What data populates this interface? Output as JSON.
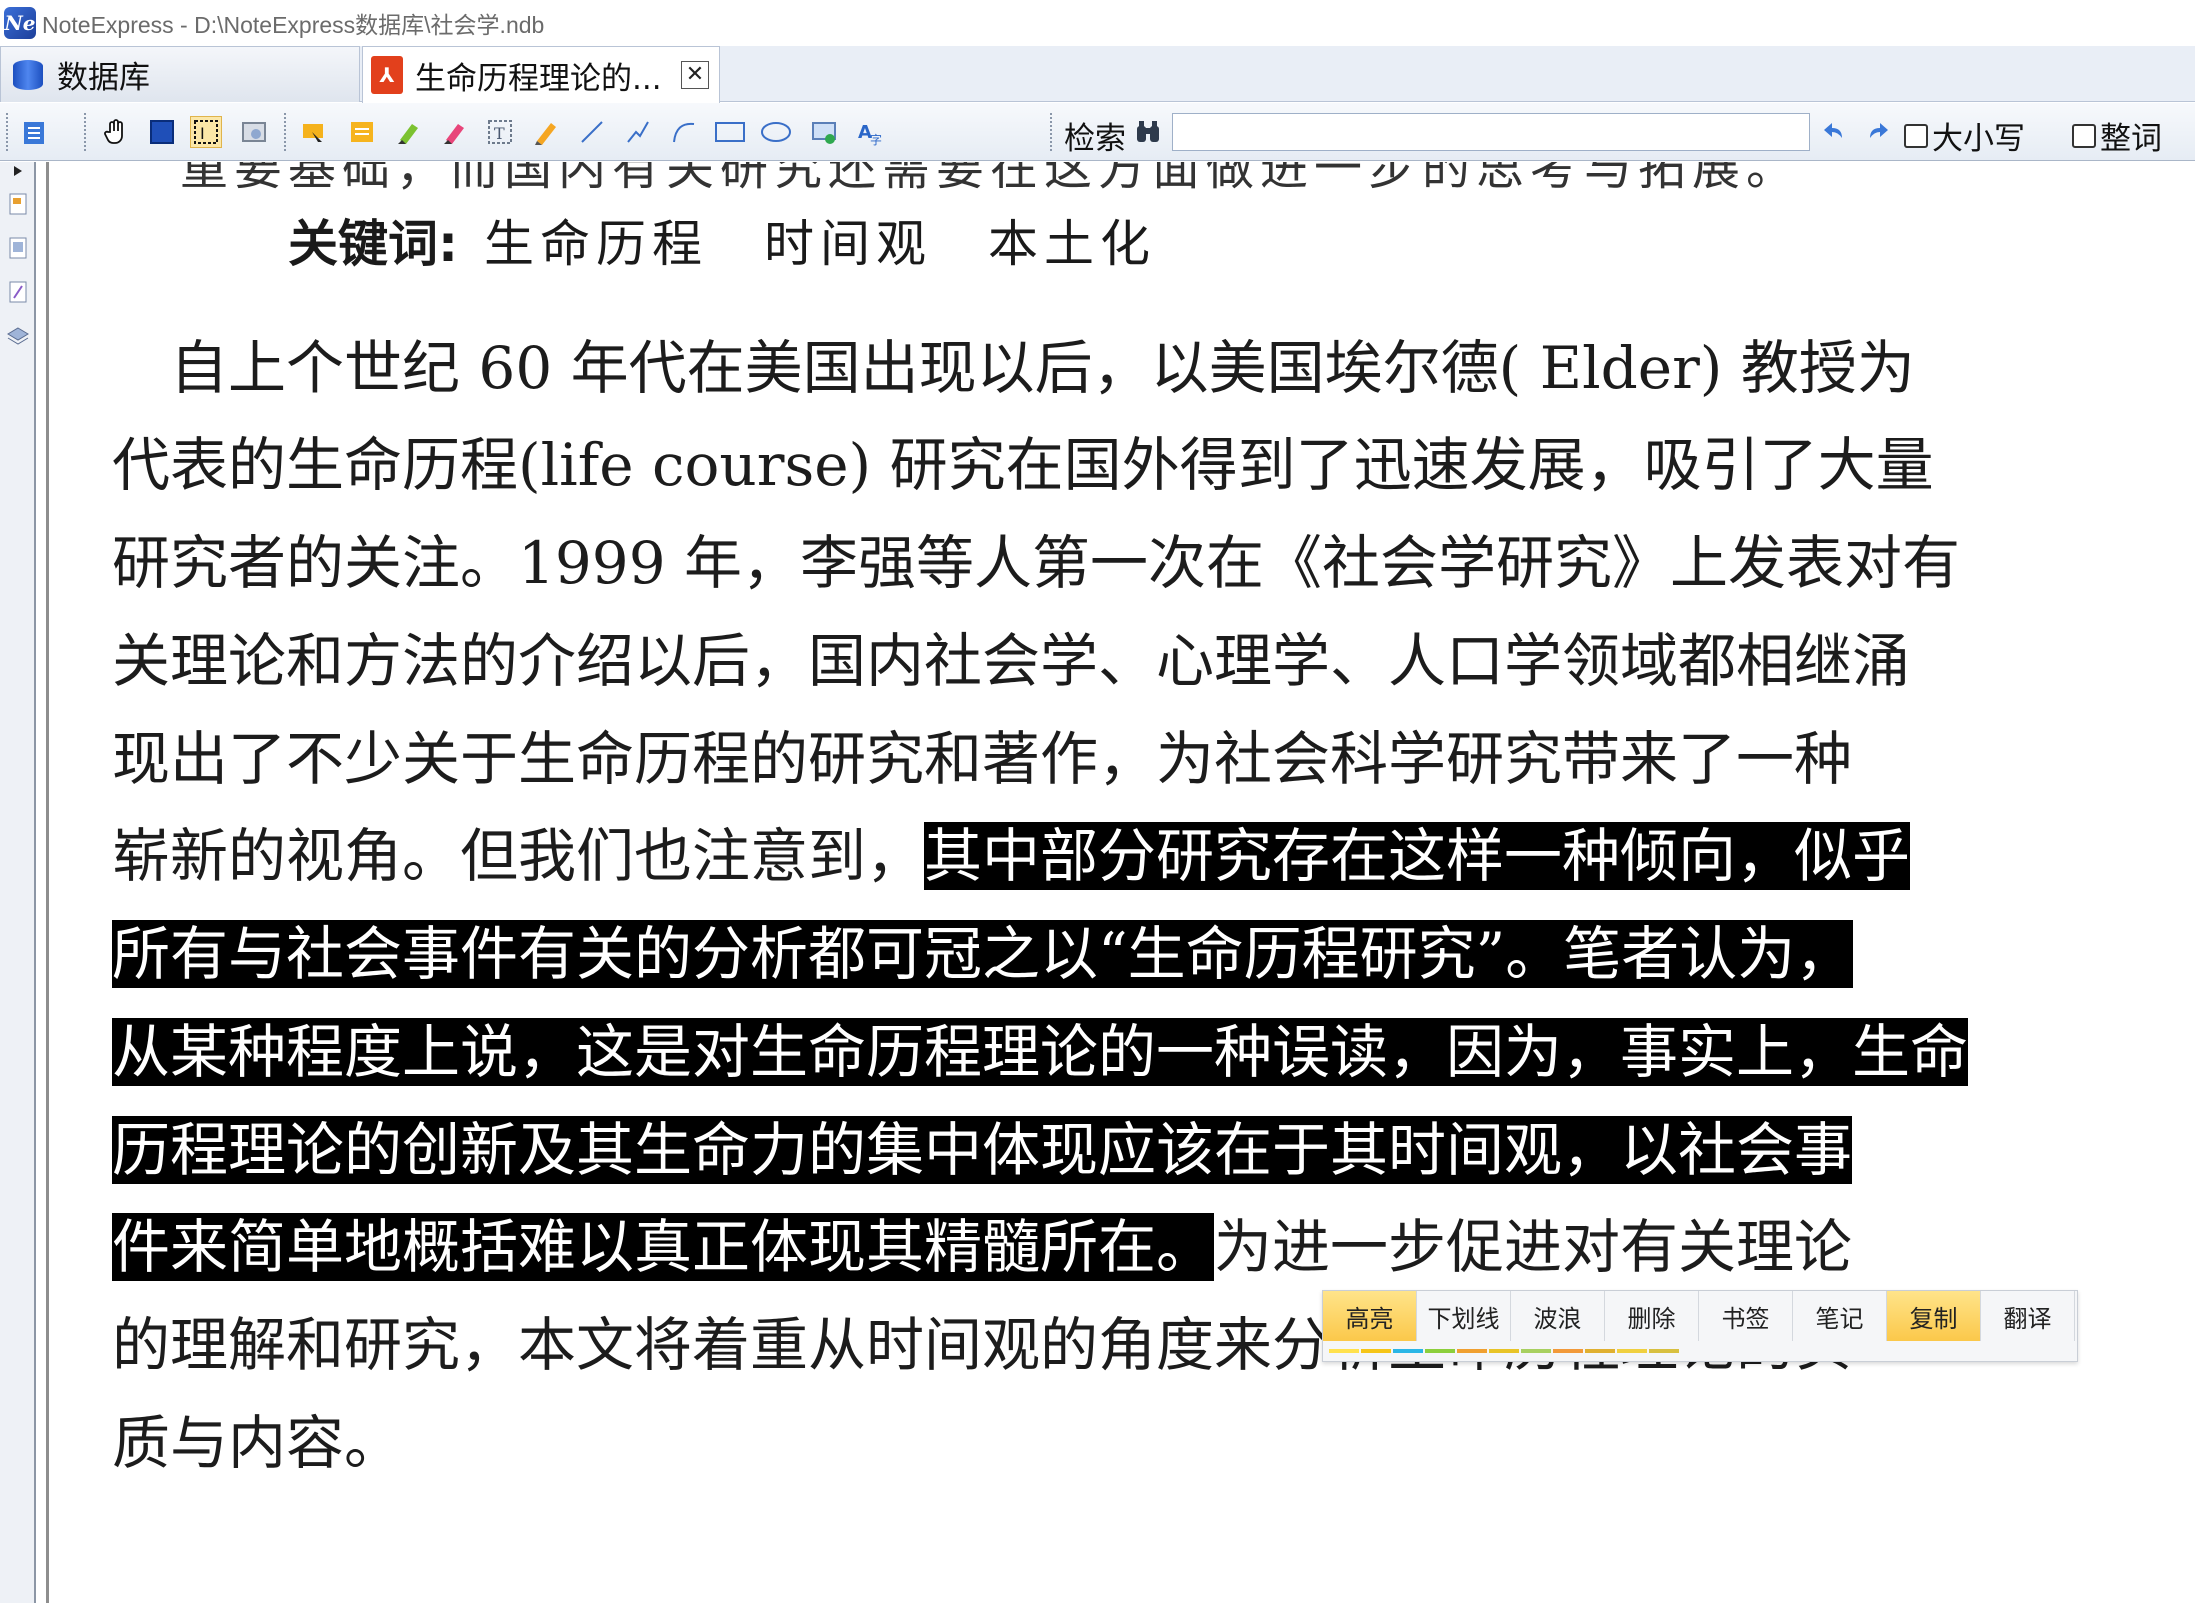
{
  "window": {
    "logo_text": "Ne",
    "title": "NoteExpress - D:\\NoteExpress数据库\\社会学.ndb"
  },
  "tabs": [
    {
      "label": "数据库"
    },
    {
      "label": "生命历程理论的..."
    }
  ],
  "toolbar": {
    "search_label": "检索",
    "search_value": "",
    "match_case_label": "大小写",
    "whole_word_label": "整词"
  },
  "document": {
    "cut_line": "重要基础，而国内有关研究还需要在这方面做进一步的思考与拓展。",
    "keywords_label": "关键词:",
    "keywords_values": "生命历程　时间观　本土化",
    "lines": [
      {
        "segments": [
          {
            "text": "　自上个世纪 60 年代在美国出现以后，以美国埃尔德( Elder) 教授为",
            "hl": false
          }
        ]
      },
      {
        "segments": [
          {
            "text": "代表的生命历程(life course) 研究在国外得到了迅速发展，吸引了大量",
            "hl": false
          }
        ]
      },
      {
        "segments": [
          {
            "text": "研究者的关注。1999 年，李强等人第一次在《社会学研究》上发表对有",
            "hl": false
          }
        ]
      },
      {
        "segments": [
          {
            "text": "关理论和方法的介绍以后，国内社会学、心理学、人口学领域都相继涌",
            "hl": false
          }
        ]
      },
      {
        "segments": [
          {
            "text": "现出了不少关于生命历程的研究和著作，为社会科学研究带来了一种",
            "hl": false
          }
        ]
      },
      {
        "segments": [
          {
            "text": "崭新的视角。但我们也注意到，",
            "hl": false
          },
          {
            "text": "其中部分研究存在这样一种倾向，似乎",
            "hl": true
          }
        ]
      },
      {
        "segments": [
          {
            "text": "所有与社会事件有关的分析都可冠之以“生命历程研究”。笔者认为，",
            "hl": true
          }
        ]
      },
      {
        "segments": [
          {
            "text": "从某种程度上说，这是对生命历程理论的一种误读，因为，事实上，生命",
            "hl": true
          }
        ]
      },
      {
        "segments": [
          {
            "text": "历程理论的创新及其生命力的集中体现应该在于其时间观，以社会事",
            "hl": true
          }
        ]
      },
      {
        "segments": [
          {
            "text": "件来简单地概括难以真正体现其精髓所在。",
            "hl": true
          },
          {
            "text": "为进一步促进对有关理论",
            "hl": false
          }
        ]
      },
      {
        "segments": [
          {
            "text": "的理解和研究，本文将着重从时间观的角度来分析生命历程理论的实",
            "hl": false
          }
        ]
      },
      {
        "segments": [
          {
            "text": "质与内容。",
            "hl": false
          }
        ]
      }
    ]
  },
  "popup": {
    "buttons": [
      "高亮",
      "下划线",
      "波浪",
      "删除",
      "书签",
      "笔记",
      "复制",
      "翻译"
    ],
    "active": [
      "高亮",
      "复制"
    ],
    "swatches": [
      "#ffe14d",
      "#f5c518",
      "#2bb6e6",
      "#8ccf3c",
      "#f0a030",
      "#e8c428",
      "#a8d060",
      "#f29a3a",
      "#e0b030",
      "#f0d040",
      "#d8c040"
    ]
  }
}
